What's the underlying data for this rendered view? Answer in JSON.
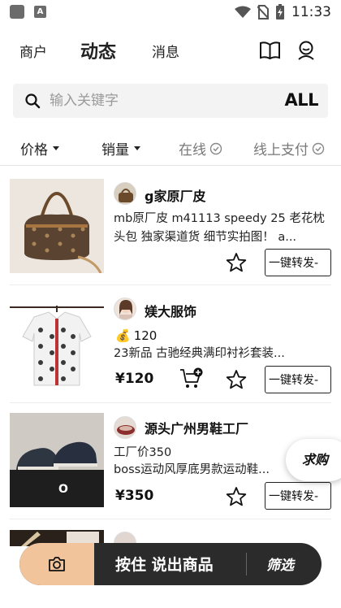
{
  "status_bar": {
    "time": "11:33",
    "icons": [
      "app-notification-icon",
      "a-notification-icon",
      "wifi-icon",
      "no-sim-icon",
      "battery-charging-icon"
    ]
  },
  "nav": {
    "tabs": [
      {
        "label": "商户",
        "active": false
      },
      {
        "label": "动态",
        "active": true
      },
      {
        "label": "消息",
        "active": false
      }
    ],
    "icons": [
      "book-icon",
      "user-icon"
    ]
  },
  "search": {
    "placeholder": "输入关键字",
    "all_label": "ALL"
  },
  "filters": [
    {
      "label": "价格",
      "has_caret": true
    },
    {
      "label": "销量",
      "has_caret": true
    },
    {
      "label": "在线",
      "has_check": true
    },
    {
      "label": "线上支付",
      "has_check": true
    }
  ],
  "products": [
    {
      "seller": "g家原厂皮",
      "desc": "mb原厂皮  m41113 speedy 25 老花枕头包 独家渠道货 细节实拍图！ a...",
      "price": "",
      "forward_label": "一键转发-"
    },
    {
      "seller": "媄大服饰",
      "price_tag": "120",
      "desc": "23新品 古驰经典满印衬衫套装...",
      "price": "¥120",
      "forward_label": "一键转发-"
    },
    {
      "seller": "源头广州男鞋工厂",
      "price_tag": "工厂价350",
      "desc": "boss运动风厚底男款运动鞋...",
      "price": "¥350",
      "forward_label": "一键转发-"
    }
  ],
  "float_button": "求购",
  "bottom_bar": {
    "voice_label": "按住 说出商品",
    "filter_label": "筛选"
  },
  "colors": {
    "accent_peach": "#f1c49b",
    "bottom_bar_dark": "#2b2b2b",
    "search_bg": "#f3f3f3"
  }
}
